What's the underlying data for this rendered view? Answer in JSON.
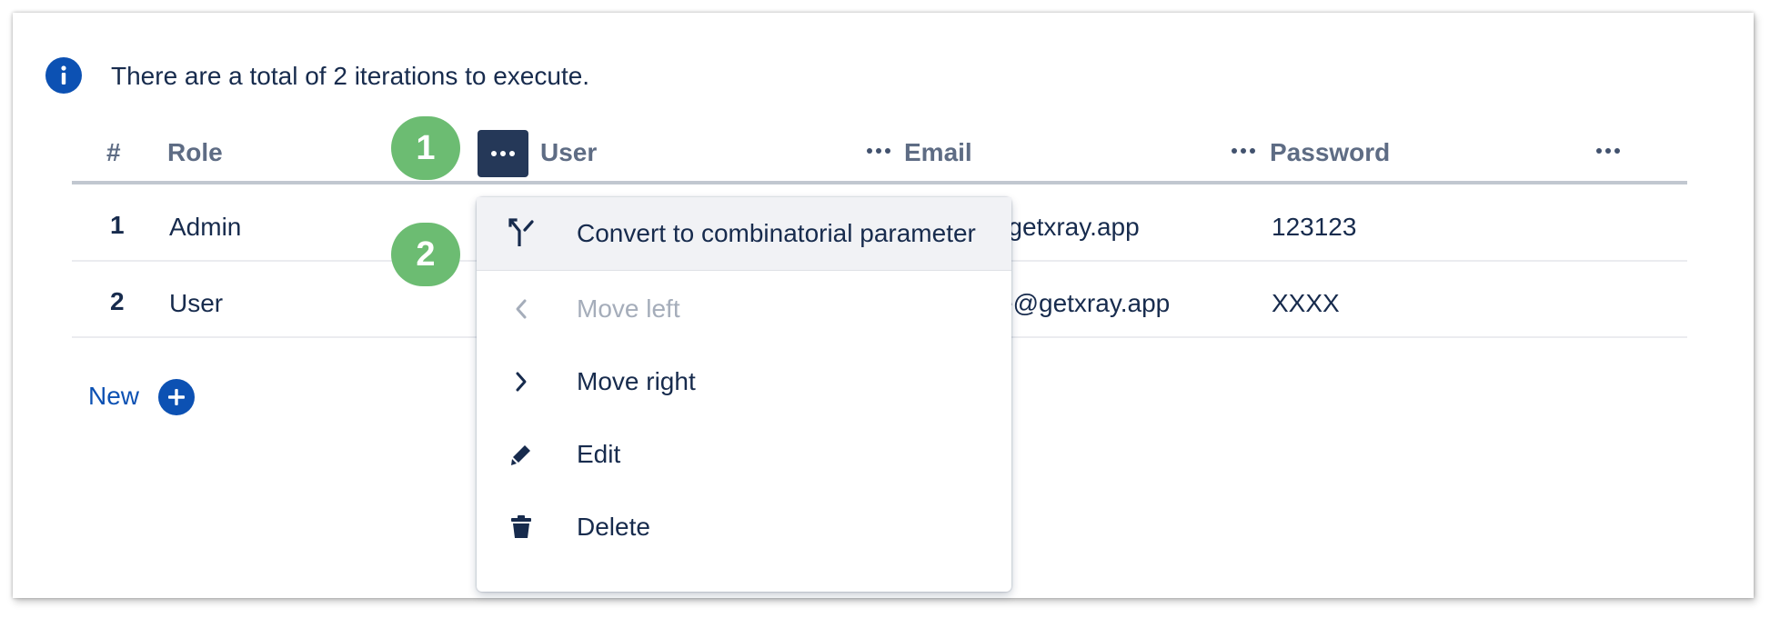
{
  "info": {
    "text": "There are a total of 2 iterations to execute."
  },
  "table": {
    "columns": [
      {
        "label": "#"
      },
      {
        "label": "Role"
      },
      {
        "label": "User"
      },
      {
        "label": "Email"
      },
      {
        "label": "Password"
      }
    ],
    "rows": [
      {
        "num": "1",
        "role": "Admin",
        "email": "@getxray.app",
        "password": "123123"
      },
      {
        "num": "2",
        "role": "User",
        "email": "e@getxray.app",
        "password": "XXXX"
      }
    ],
    "new_label": "New"
  },
  "annotations": [
    {
      "label": "1"
    },
    {
      "label": "2"
    }
  ],
  "context_menu": {
    "items": [
      {
        "label": "Convert to combinatorial parameter",
        "icon": "merge-icon",
        "highlighted": true
      },
      {
        "label": "Move left",
        "icon": "chevron-left-icon",
        "disabled": true
      },
      {
        "label": "Move right",
        "icon": "chevron-right-icon"
      },
      {
        "label": "Edit",
        "icon": "pencil-icon"
      },
      {
        "label": "Delete",
        "icon": "trash-icon"
      }
    ]
  },
  "colors": {
    "primary_blue": "#0c51b3",
    "badge_green": "#6cbc72",
    "active_menu_button": "#253858",
    "header_text": "#5e6c84",
    "body_text": "#172b4d",
    "disabled_text": "#a5adba"
  }
}
